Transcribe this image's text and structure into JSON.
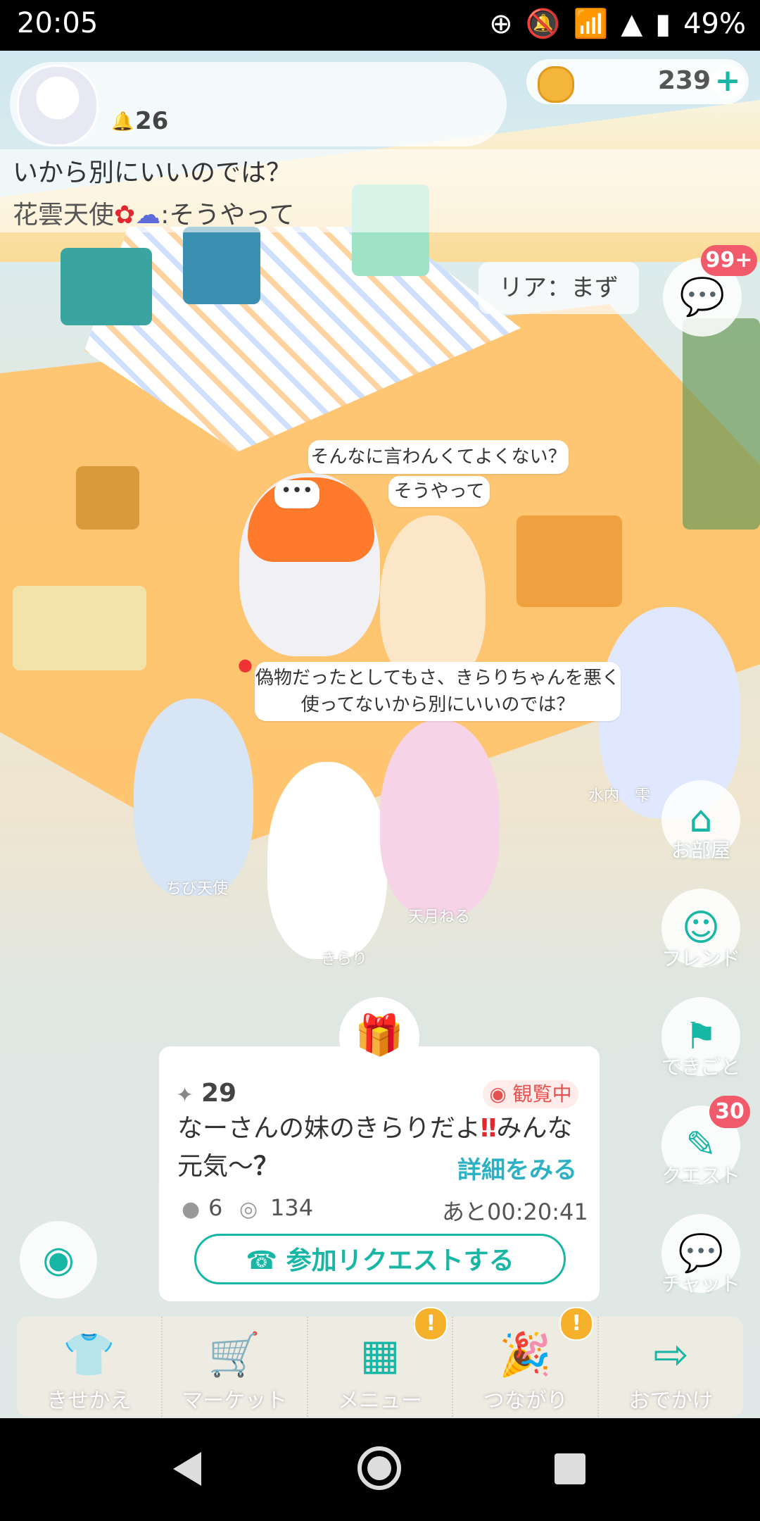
{
  "status_bar": {
    "time": "20:05",
    "battery": "49%",
    "icons": [
      "add-circle-icon",
      "bell-off-icon",
      "wifi-icon",
      "signal-icon",
      "battery-icon"
    ]
  },
  "profile": {
    "notification_count": "26"
  },
  "coins": {
    "value": "239",
    "plus": "+"
  },
  "chat_log": {
    "line1": "いから別にいいのでは？",
    "line2_name": "花雲天使",
    "line2_message": "そうやって",
    "line2_flower": "✿",
    "line2_cloud": "☁",
    "line2_sep": ":"
  },
  "floating_chat": "リア：まず",
  "bubbles": {
    "b1": "そんなに言わんくてよくない？",
    "b2": "そうやって",
    "typing": "•••",
    "b4_line1": "偽物だったとしてもさ、きらりちゃんを悪く",
    "b4_line2": "使ってないから別にいいのでは？"
  },
  "characters": {
    "names": [
      "水内　雫",
      "ちび天使",
      "きらり",
      "天月ねる"
    ]
  },
  "side_menu": {
    "chat_badge": "99+",
    "items": [
      {
        "label": "お部屋",
        "icon": "house-icon"
      },
      {
        "label": "フレンド",
        "icon": "friends-icon"
      },
      {
        "label": "できごと",
        "icon": "flag-icon"
      },
      {
        "label": "クエスト",
        "icon": "quest-icon",
        "badge": "30"
      },
      {
        "label": "チャット",
        "icon": "chat-icon"
      }
    ]
  },
  "event_card": {
    "party_count": "29",
    "status": "観覧中",
    "title_part1": "なーさんの妹のきらりだよ",
    "title_mark": "‼",
    "title_part2": "みんな元気〜",
    "title_q": "？",
    "detail_link": "詳細をみる",
    "participants": "6",
    "views": "134",
    "remaining": "あと00:20:41",
    "join_button": "参加リクエストする"
  },
  "bottom_nav": {
    "items": [
      {
        "label": "きせかえ",
        "icon": "shirt-icon"
      },
      {
        "label": "マーケット",
        "icon": "cart-icon"
      },
      {
        "label": "メニュー",
        "icon": "grid-menu-icon",
        "badge": "!"
      },
      {
        "label": "つながり",
        "icon": "party-popper-icon",
        "badge": "!"
      },
      {
        "label": "おでかけ",
        "icon": "exit-icon"
      }
    ]
  },
  "colors": {
    "accent": "#18b6a4",
    "badge_red": "#f05a6a",
    "badge_orange": "#f5b12b",
    "watching_red": "#e85050",
    "link_blue": "#2cb0c4"
  }
}
